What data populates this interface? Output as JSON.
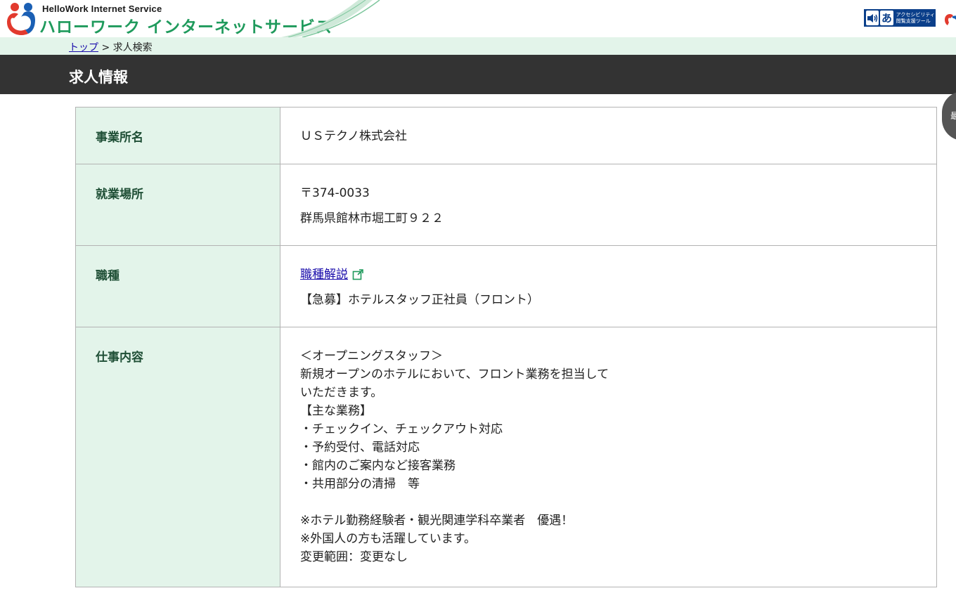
{
  "header": {
    "logo_sub": "HelloWork Internet Service",
    "logo_main": "ハローワーク インターネットサービス",
    "a11y_label_line1": "アクセシビリティ",
    "a11y_label_line2": "閲覧支援ツール",
    "a11y_glyph": "あ"
  },
  "breadcrumb": {
    "home_link": "トップ",
    "separator": " > ",
    "current": "求人検索"
  },
  "page_title": "求人情報",
  "side_tab_label": "最",
  "rows": [
    {
      "label": "事業所名",
      "value": "ＵＳテクノ株式会社"
    },
    {
      "label": "就業場所",
      "postal": "〒374-0033",
      "address": "群馬県館林市堀工町９２２"
    },
    {
      "label": "職種",
      "link_text": "職種解説",
      "value": "【急募】ホテルスタッフ正社員（フロント）"
    },
    {
      "label": "仕事内容",
      "value": "＜オープニングスタッフ＞\n新規オープンのホテルにおいて、フロント業務を担当して\nいただきます。\n【主な業務】\n・チェックイン、チェックアウト対応\n・予約受付、電話対応\n・館内のご案内など接客業務\n・共用部分の清掃　等\n\n※ホテル勤務経験者・観光関連学科卒業者　優遇！\n※外国人の方も活躍しています。\n変更範囲：変更なし"
    }
  ],
  "colors": {
    "brand_green": "#1f9a5c",
    "label_bg": "#e3f4ea",
    "title_bar": "#333333",
    "link": "#1a0dab",
    "a11y_blue": "#0b3f8a"
  }
}
